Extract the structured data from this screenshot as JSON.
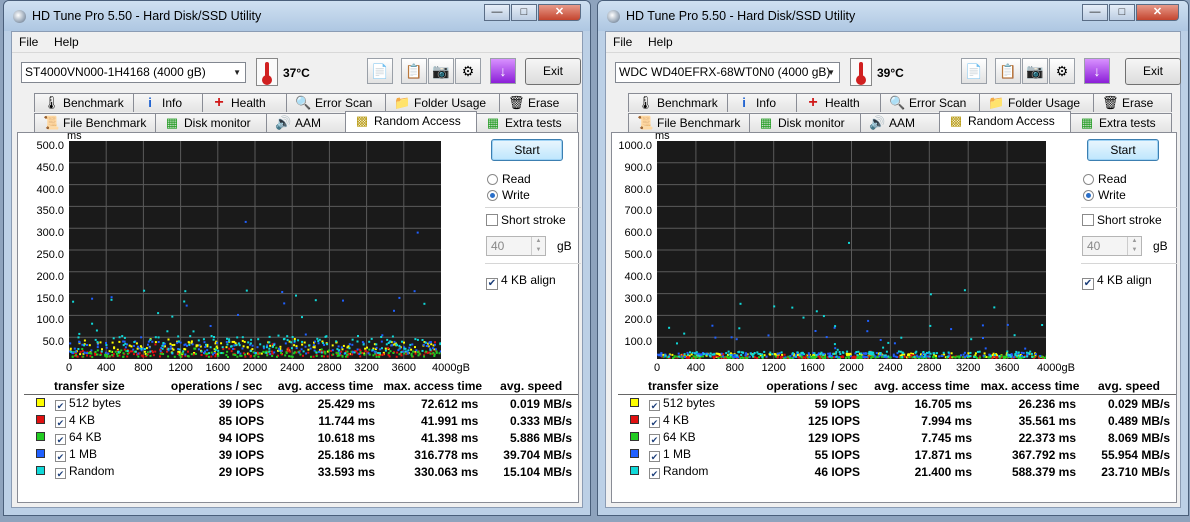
{
  "windows": [
    {
      "title": "HD Tune Pro 5.50 - Hard Disk/SSD Utility",
      "menu": [
        "File",
        "Help"
      ],
      "drive": "ST4000VN000-1H4168 (4000 gB)",
      "temperature": "37°C",
      "exit_label": "Exit",
      "tabs_row1": [
        "Benchmark",
        "Info",
        "Health",
        "Error Scan",
        "Folder Usage",
        "Erase"
      ],
      "tabs_row2": [
        "File Benchmark",
        "Disk monitor",
        "AAM",
        "Random Access",
        "Extra tests"
      ],
      "active_tab": "Random Access",
      "start_label": "Start",
      "read_label": "Read",
      "write_label": "Write",
      "mode": "Write",
      "short_stroke_label": "Short stroke",
      "stroke_value": "40",
      "stroke_unit": "gB",
      "align_label": "4 KB align",
      "align_checked": true,
      "results": {
        "headers": [
          "transfer size",
          "operations / sec",
          "avg. access time",
          "max. access time",
          "avg. speed"
        ],
        "rows": [
          {
            "size": "512 bytes",
            "ops": "39 IOPS",
            "avg": "25.429 ms",
            "max": "72.612 ms",
            "speed": "0.019 MB/s"
          },
          {
            "size": "4 KB",
            "ops": "85 IOPS",
            "avg": "11.744 ms",
            "max": "41.991 ms",
            "speed": "0.333 MB/s"
          },
          {
            "size": "64 KB",
            "ops": "94 IOPS",
            "avg": "10.618 ms",
            "max": "41.398 ms",
            "speed": "5.886 MB/s"
          },
          {
            "size": "1 MB",
            "ops": "39 IOPS",
            "avg": "25.186 ms",
            "max": "316.778 ms",
            "speed": "39.704 MB/s"
          },
          {
            "size": "Random",
            "ops": "29 IOPS",
            "avg": "33.593 ms",
            "max": "330.063 ms",
            "speed": "15.104 MB/s"
          }
        ]
      }
    },
    {
      "title": "HD Tune Pro 5.50 - Hard Disk/SSD Utility",
      "menu": [
        "File",
        "Help"
      ],
      "drive": "WDC WD40EFRX-68WT0N0 (4000 gB)",
      "temperature": "39°C",
      "exit_label": "Exit",
      "tabs_row1": [
        "Benchmark",
        "Info",
        "Health",
        "Error Scan",
        "Folder Usage",
        "Erase"
      ],
      "tabs_row2": [
        "File Benchmark",
        "Disk monitor",
        "AAM",
        "Random Access",
        "Extra tests"
      ],
      "active_tab": "Random Access",
      "start_label": "Start",
      "read_label": "Read",
      "write_label": "Write",
      "mode": "Write",
      "short_stroke_label": "Short stroke",
      "stroke_value": "40",
      "stroke_unit": "gB",
      "align_label": "4 KB align",
      "align_checked": true,
      "results": {
        "headers": [
          "transfer size",
          "operations / sec",
          "avg. access time",
          "max. access time",
          "avg. speed"
        ],
        "rows": [
          {
            "size": "512 bytes",
            "ops": "59 IOPS",
            "avg": "16.705 ms",
            "max": "26.236 ms",
            "speed": "0.029 MB/s"
          },
          {
            "size": "4 KB",
            "ops": "125 IOPS",
            "avg": "7.994 ms",
            "max": "35.561 ms",
            "speed": "0.489 MB/s"
          },
          {
            "size": "64 KB",
            "ops": "129 IOPS",
            "avg": "7.745 ms",
            "max": "22.373 ms",
            "speed": "8.069 MB/s"
          },
          {
            "size": "1 MB",
            "ops": "55 IOPS",
            "avg": "17.871 ms",
            "max": "367.792 ms",
            "speed": "55.954 MB/s"
          },
          {
            "size": "Random",
            "ops": "46 IOPS",
            "avg": "21.400 ms",
            "max": "588.379 ms",
            "speed": "23.710 MB/s"
          }
        ]
      }
    }
  ],
  "series_colors": {
    "512 bytes": "#ffff00",
    "4 KB": "#e01010",
    "64 KB": "#22cc22",
    "1 MB": "#2060ff",
    "Random": "#10d8d8"
  },
  "chart_data": [
    {
      "type": "scatter",
      "title": "",
      "ylabel": "ms",
      "xlabel": "gB",
      "xlim": [
        0,
        4000
      ],
      "ylim": [
        0,
        500
      ],
      "y_ticks": [
        "500.0",
        "450.0",
        "400.0",
        "350.0",
        "300.0",
        "250.0",
        "200.0",
        "150.0",
        "100.0",
        "50.0"
      ],
      "x_ticks": [
        "0",
        "400",
        "800",
        "1200",
        "1600",
        "2000",
        "2400",
        "2800",
        "3200",
        "3600",
        "4000gB"
      ],
      "series": [
        {
          "name": "512 bytes",
          "avg_ms": 25.429,
          "max_ms": 72.612
        },
        {
          "name": "4 KB",
          "avg_ms": 11.744,
          "max_ms": 41.991
        },
        {
          "name": "64 KB",
          "avg_ms": 10.618,
          "max_ms": 41.398
        },
        {
          "name": "1 MB",
          "avg_ms": 25.186,
          "max_ms": 316.778
        },
        {
          "name": "Random",
          "avg_ms": 33.593,
          "max_ms": 330.063
        }
      ]
    },
    {
      "type": "scatter",
      "title": "",
      "ylabel": "ms",
      "xlabel": "gB",
      "xlim": [
        0,
        4000
      ],
      "ylim": [
        0,
        1000
      ],
      "y_ticks": [
        "1000.0",
        "900.0",
        "800.0",
        "700.0",
        "600.0",
        "500.0",
        "400.0",
        "300.0",
        "200.0",
        "100.0"
      ],
      "x_ticks": [
        "0",
        "400",
        "800",
        "1200",
        "1600",
        "2000",
        "2400",
        "2800",
        "3200",
        "3600",
        "4000gB"
      ],
      "series": [
        {
          "name": "512 bytes",
          "avg_ms": 16.705,
          "max_ms": 26.236
        },
        {
          "name": "4 KB",
          "avg_ms": 7.994,
          "max_ms": 35.561
        },
        {
          "name": "64 KB",
          "avg_ms": 7.745,
          "max_ms": 22.373
        },
        {
          "name": "1 MB",
          "avg_ms": 17.871,
          "max_ms": 367.792
        },
        {
          "name": "Random",
          "avg_ms": 21.4,
          "max_ms": 588.379
        }
      ]
    }
  ]
}
